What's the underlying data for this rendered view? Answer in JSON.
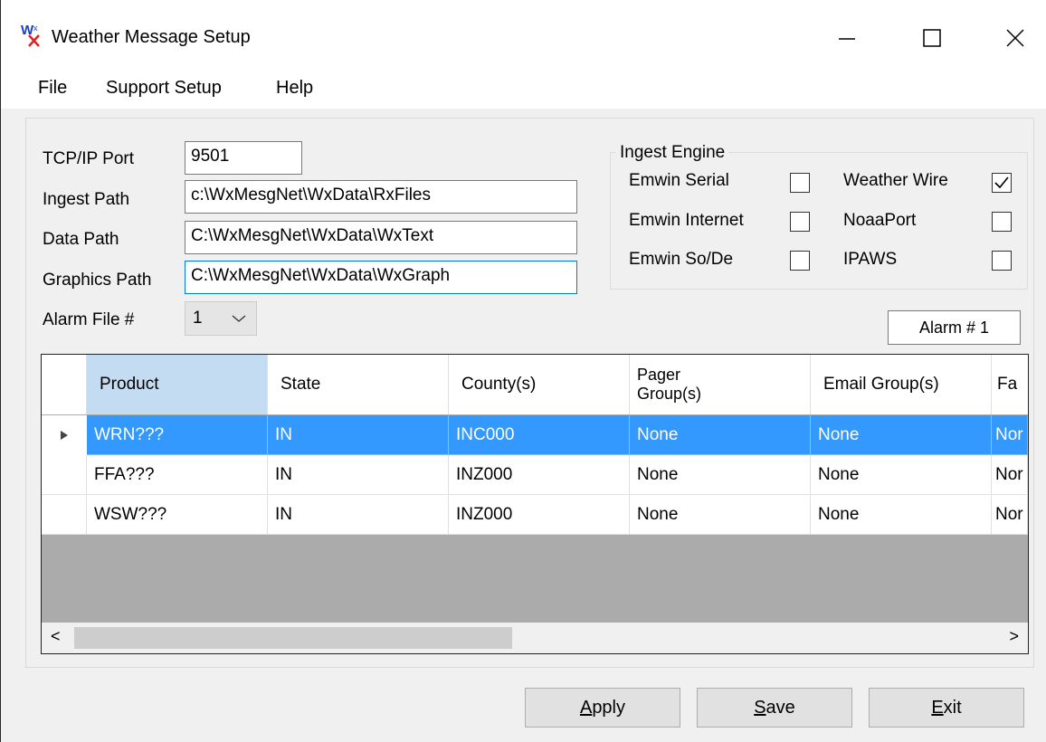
{
  "window": {
    "title": "Weather Message Setup",
    "controls": {
      "minimize": "—",
      "maximize": "☐",
      "close": "✕"
    }
  },
  "menu": [
    "File",
    "Support Setup",
    "Help"
  ],
  "fields": {
    "tcp_label": "TCP/IP Port",
    "tcp_value": "9501",
    "ingest_label": "Ingest Path",
    "ingest_value": "c:\\WxMesgNet\\WxData\\RxFiles",
    "data_label": "Data Path",
    "data_value": "C:\\WxMesgNet\\WxData\\WxText",
    "graphics_label": "Graphics Path",
    "graphics_value": "C:\\WxMesgNet\\WxData\\WxGraph",
    "alarm_file_label": "Alarm File #",
    "alarm_file_value": "1"
  },
  "ingest_engine": {
    "title": "Ingest Engine",
    "options": [
      {
        "label": "Emwin Serial",
        "checked": false
      },
      {
        "label": "Weather Wire",
        "checked": true
      },
      {
        "label": "Emwin Internet",
        "checked": false
      },
      {
        "label": "NoaaPort",
        "checked": false
      },
      {
        "label": "Emwin So/De",
        "checked": false
      },
      {
        "label": "IPAWS",
        "checked": false
      }
    ]
  },
  "alarm_indicator": "Alarm # 1",
  "grid": {
    "columns": [
      "Product",
      "State",
      "County(s)",
      "Pager\nGroup(s)",
      "Email Group(s)",
      "Fa"
    ],
    "rows": [
      [
        "WRN???",
        "IN",
        "INC000",
        "None",
        "None",
        "Nor"
      ],
      [
        "FFA???",
        "IN",
        "INZ000",
        "None",
        "None",
        "Nor"
      ],
      [
        "WSW???",
        "IN",
        "INZ000",
        "None",
        "None",
        "Nor"
      ]
    ],
    "selected_row": 0,
    "scroll_left": "<",
    "scroll_right": ">"
  },
  "buttons": {
    "apply_mnemonic": "A",
    "apply_rest": "pply",
    "save_mnemonic": "S",
    "save_rest": "ave",
    "exit_mnemonic": "E",
    "exit_rest": "xit"
  },
  "colors": {
    "selection": "#3399ff",
    "header_selected": "#c4dcf1",
    "grid_background": "#ababab"
  }
}
